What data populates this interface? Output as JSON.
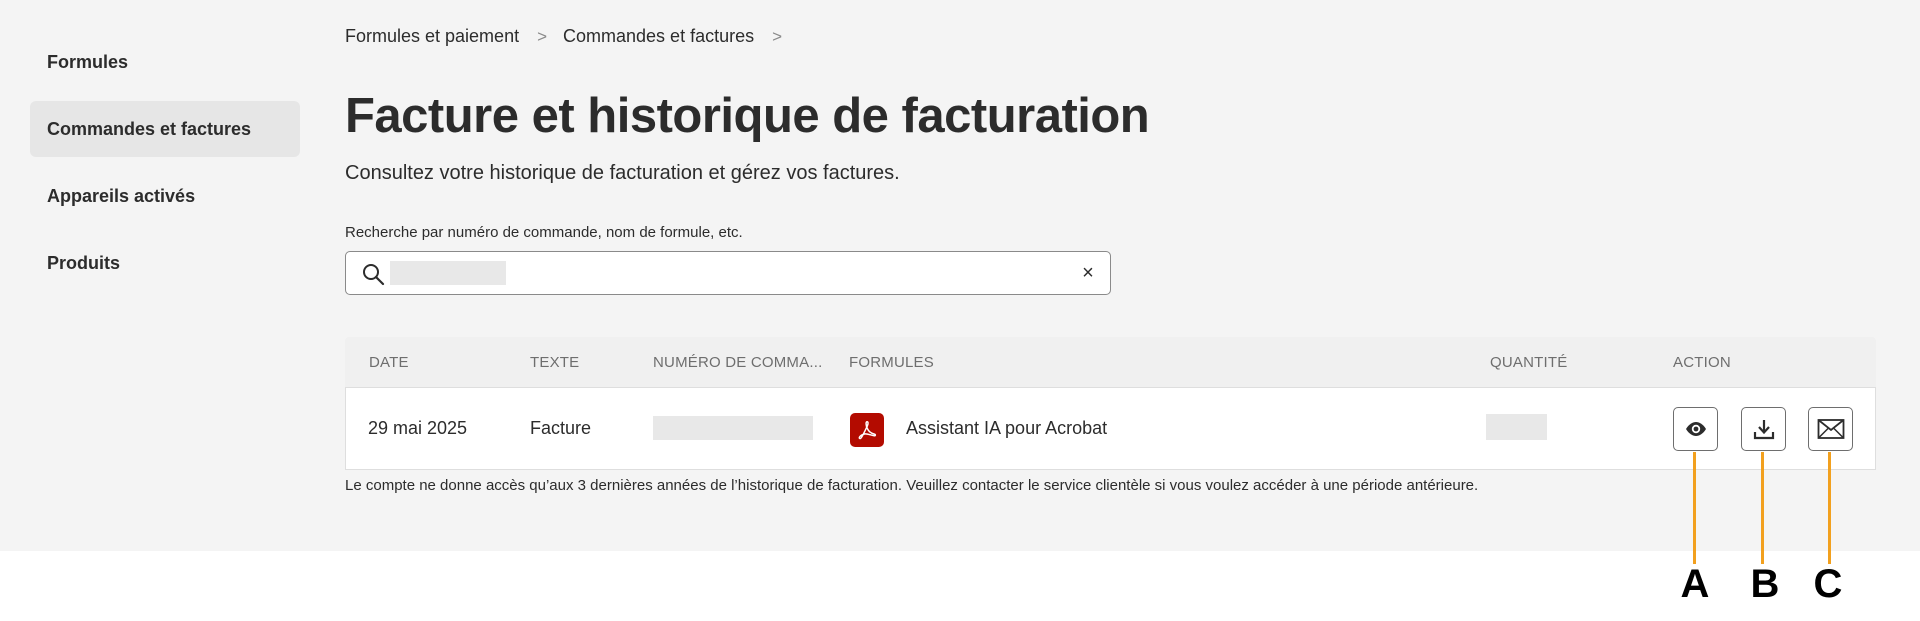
{
  "sidebar": {
    "items": [
      {
        "label": "Formules",
        "active": false
      },
      {
        "label": "Commandes et factures",
        "active": true
      },
      {
        "label": "Appareils activés",
        "active": false
      },
      {
        "label": "Produits",
        "active": false
      }
    ]
  },
  "breadcrumb": {
    "items": [
      "Formules et paiement",
      "Commandes et factures"
    ],
    "separator": ">"
  },
  "page": {
    "title": "Facture et historique de facturation",
    "subtitle": "Consultez votre historique de facturation et gérez vos factures."
  },
  "search": {
    "label": "Recherche par numéro de commande, nom de formule, etc.",
    "value": "",
    "clear": "×"
  },
  "table": {
    "columns": [
      "DATE",
      "TEXTE",
      "NUMÉRO DE COMMA...",
      "FORMULES",
      "QUANTITÉ",
      "ACTION"
    ],
    "rows": [
      {
        "date": "29 mai 2025",
        "type": "Facture",
        "order_number": "",
        "plan": "Assistant IA pour Acrobat",
        "plan_icon": "acrobat-pdf-icon",
        "quantity": "",
        "actions": [
          "eye-icon",
          "download-icon",
          "mail-icon"
        ]
      }
    ]
  },
  "footnote": "Le compte ne donne accès qu’aux 3 dernières années de l’historique de facturation. Veuillez contacter le service clientèle si vous voulez accéder à une période antérieure.",
  "callouts": {
    "a": "A",
    "b": "B",
    "c": "C",
    "color": "#f2a01e"
  },
  "colors": {
    "background": "#f4f4f4",
    "active_nav": "#e6e6e6",
    "acrobat_red": "#b30b00"
  }
}
